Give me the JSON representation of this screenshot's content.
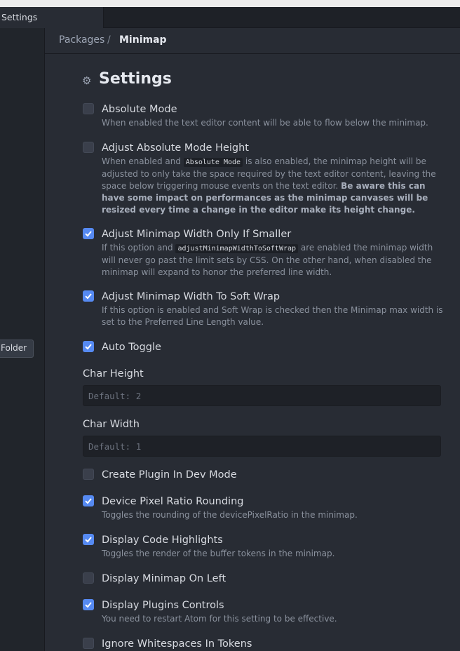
{
  "tab": {
    "title": "Settings"
  },
  "side_panel": {
    "folder_button": "Folder"
  },
  "breadcrumb": {
    "parent": "Packages",
    "separator": "/",
    "current": "Minimap"
  },
  "section": {
    "title": "Settings",
    "icon": "gear-icon"
  },
  "settings": [
    {
      "label": "Absolute Mode",
      "checked": false,
      "desc": "When enabled the text editor content will be able to flow below the minimap."
    },
    {
      "label": "Adjust Absolute Mode Height",
      "checked": false,
      "desc_a": "When enabled and ",
      "desc_code": "Absolute Mode",
      "desc_b": " is also enabled, the minimap height will be adjusted to only take the space required by the text editor content, leaving the space below triggering mouse events on the text editor. ",
      "desc_bold": "Be aware this can have some impact on performances as the minimap canvases will be resized every time a change in the editor make its height change."
    },
    {
      "label": "Adjust Minimap Width Only If Smaller",
      "checked": true,
      "desc_a": "If this option and ",
      "desc_code": "adjustMinimapWidthToSoftWrap",
      "desc_b": " are enabled the minimap width will never go past the limit sets by CSS. On the other hand, when disabled the minimap will expand to honor the preferred line width."
    },
    {
      "label": "Adjust Minimap Width To Soft Wrap",
      "checked": true,
      "desc": "If this option is enabled and Soft Wrap is checked then the Minimap max width is set to the Preferred Line Length value."
    },
    {
      "label": "Auto Toggle",
      "checked": true
    },
    {
      "label": "Create Plugin In Dev Mode",
      "checked": false
    },
    {
      "label": "Device Pixel Ratio Rounding",
      "checked": true,
      "desc": "Toggles the rounding of the devicePixelRatio in the minimap."
    },
    {
      "label": "Display Code Highlights",
      "checked": true,
      "desc": "Toggles the render of the buffer tokens in the minimap."
    },
    {
      "label": "Display Minimap On Left",
      "checked": false
    },
    {
      "label": "Display Plugins Controls",
      "checked": true,
      "desc": "You need to restart Atom for this setting to be effective."
    },
    {
      "label": "Ignore Whitespaces In Tokens",
      "checked": false
    }
  ],
  "fields": [
    {
      "label": "Char Height",
      "placeholder": "Default: 2",
      "value": ""
    },
    {
      "label": "Char Width",
      "placeholder": "Default: 1",
      "value": ""
    }
  ],
  "colors": {
    "accent": "#568af2",
    "background": "#282c34",
    "panel": "#21252b"
  }
}
